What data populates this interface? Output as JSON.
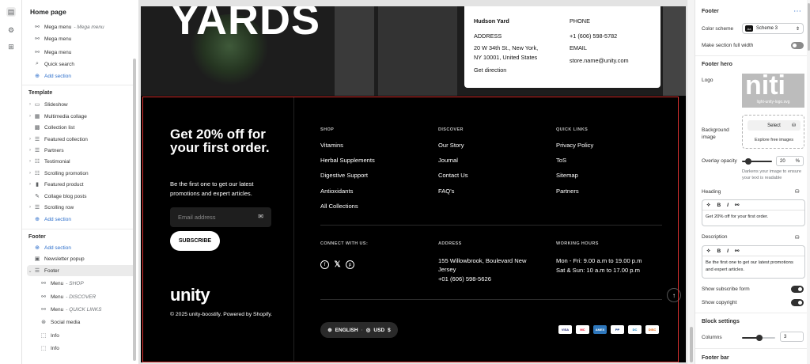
{
  "rail": {
    "icons": [
      "sections-icon",
      "gear-icon",
      "apps-icon"
    ]
  },
  "left": {
    "page_title": "Home page",
    "header_rows": [
      {
        "label": "Mega menu",
        "sub": "- Mega menu",
        "icon": "link-icon"
      },
      {
        "label": "Mega menu",
        "sub": "",
        "icon": "link-icon"
      },
      {
        "label": "Mega menu",
        "sub": "",
        "icon": "link-icon"
      },
      {
        "label": "Quick search",
        "sub": "",
        "icon": "search-icon"
      }
    ],
    "add_section": "Add section",
    "template_title": "Template",
    "template_rows": [
      {
        "label": "Slideshow",
        "icon": "slideshow-icon"
      },
      {
        "label": "Multimedia collage",
        "icon": "collage-icon"
      },
      {
        "label": "Collection list",
        "icon": "collection-icon"
      },
      {
        "label": "Featured collection",
        "icon": "grid-icon"
      },
      {
        "label": "Partners",
        "icon": "grid-icon"
      },
      {
        "label": "Testimonial",
        "icon": "list-icon"
      },
      {
        "label": "Scrolling promotion",
        "icon": "list-icon"
      },
      {
        "label": "Featured product",
        "icon": "product-icon"
      },
      {
        "label": "Collage blog posts",
        "icon": "blog-icon"
      },
      {
        "label": "Scrolling row",
        "icon": "grid-icon"
      }
    ],
    "footer_title": "Footer",
    "footer_rows": [
      {
        "label": "Add section",
        "sub": "",
        "icon": "plus-icon",
        "add": true
      },
      {
        "label": "Newsletter popup",
        "sub": "",
        "icon": "popup-icon"
      },
      {
        "label": "Footer",
        "sub": "",
        "icon": "grid-icon",
        "active": true
      },
      {
        "label": "Menu",
        "sub": "- SHOP",
        "icon": "link-icon"
      },
      {
        "label": "Menu",
        "sub": "- DISCOVER",
        "icon": "link-icon"
      },
      {
        "label": "Menu",
        "sub": "- QUICK LINKS",
        "icon": "link-icon"
      },
      {
        "label": "Social media",
        "sub": "",
        "icon": "social-icon"
      },
      {
        "label": "Info",
        "sub": "",
        "icon": "block-icon"
      },
      {
        "label": "Info",
        "sub": "",
        "icon": "block-icon"
      }
    ]
  },
  "preview": {
    "hero_text": "YARDS",
    "store": {
      "name": "Hudson Yard",
      "address_label": "ADDRESS",
      "address_line1": "20 W 34th St., New York,",
      "address_line2": "NY 10001, United States",
      "direction": "Get direction",
      "phone_label": "PHONE",
      "phone": "+1 (606) 598-5782",
      "email_label": "EMAIL",
      "email": "store.name@unity.com"
    },
    "footer": {
      "heading": "Get 20% off for your first order.",
      "description": "Be the first one to get our latest promotions and expert articles.",
      "email_placeholder": "Email address",
      "subscribe": "SUBSCRIBE",
      "logo": "unity",
      "copyright": "© 2025 unity-boostify. Powered by Shopify.",
      "columns": [
        {
          "title": "SHOP",
          "links": [
            "Vitamins",
            "Herbal Supplements",
            "Digestive Support",
            "Antioxidants",
            "All Collections"
          ]
        },
        {
          "title": "DISCOVER",
          "links": [
            "Our Story",
            "Journal",
            "Contact Us",
            "FAQ's"
          ]
        },
        {
          "title": "QUICK LINKS",
          "links": [
            "Privacy Policy",
            "ToS",
            "Sitemap",
            "Partners"
          ]
        }
      ],
      "connect_title": "CONNECT WITH US:",
      "address_title": "ADDRESS",
      "address_line1": "155 Willowbrook, Boulevard New Jersey",
      "address_line2": "+01 (606) 598-5626",
      "hours_title": "WORKING HOURS",
      "hours_line1": "Mon - Fri: 9.00 a.m to 19.00 p.m",
      "hours_line2": "Sat & Sun: 10 a.m to 17.00 p.m",
      "language": "ENGLISH",
      "currency": "USD",
      "currency_symbol": "$",
      "payments": [
        "VISA",
        "MC",
        "AMEX",
        "PP",
        "DC",
        "DISC"
      ]
    }
  },
  "right": {
    "section_title": "Footer",
    "color_scheme_label": "Color scheme",
    "color_scheme_value": "Scheme 3",
    "full_width_label": "Make section full width",
    "hero_title": "Footer hero",
    "logo_label": "Logo",
    "logo_file": "light-unity-logo.svg",
    "bg_label": "Background image",
    "select_btn": "Select",
    "explore": "Explore free images",
    "overlay_label": "Overlay opacity",
    "overlay_value": "20",
    "overlay_unit": "%",
    "overlay_fraction": 0.2,
    "overlay_help": "Darkens your image to ensure your text is readable",
    "heading_label": "Heading",
    "heading_value": "Get 20% off for your first order.",
    "description_label": "Description",
    "description_value": "Be the first one to get our latest promotions and expert articles.",
    "show_subscribe": "Show subscribe form",
    "show_copyright": "Show copyright",
    "block_settings": "Block settings",
    "columns_label": "Columns",
    "columns_value": "3",
    "footer_bar": "Footer bar"
  }
}
